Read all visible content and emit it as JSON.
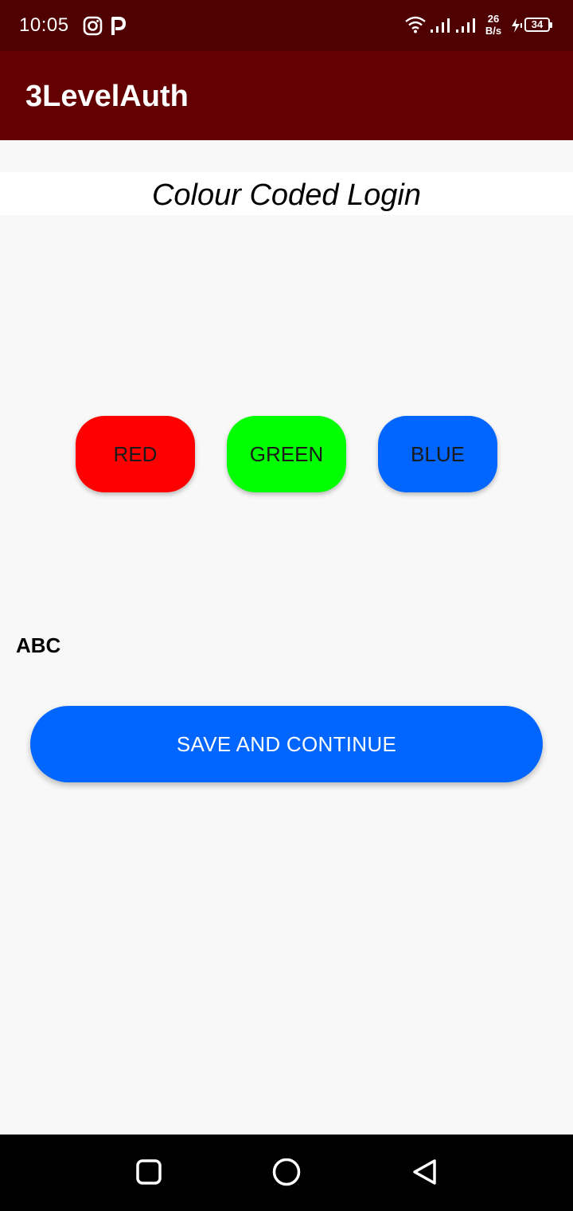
{
  "status_bar": {
    "time": "10:05",
    "icons": [
      "instagram-icon",
      "parking-icon",
      "wifi-icon",
      "signal-icon",
      "signal-icon",
      "charging-icon",
      "battery-icon"
    ],
    "speed_value": "26",
    "speed_unit": "B/s",
    "battery_level": "34"
  },
  "app_bar": {
    "title": "3LevelAuth"
  },
  "main": {
    "heading": "Colour Coded Login",
    "color_buttons": [
      {
        "label": "RED",
        "color": "#ff0000"
      },
      {
        "label": "GREEN",
        "color": "#00ff00"
      },
      {
        "label": "BLUE",
        "color": "#0066ff"
      }
    ],
    "entered_code": "ABC",
    "save_button_label": "SAVE AND CONTINUE"
  },
  "nav_bar": {
    "icons": [
      "recents-icon",
      "home-icon",
      "back-icon"
    ]
  },
  "colors": {
    "status_bar": "#4f0000",
    "app_bar": "#640000",
    "accent": "#0066ff"
  }
}
